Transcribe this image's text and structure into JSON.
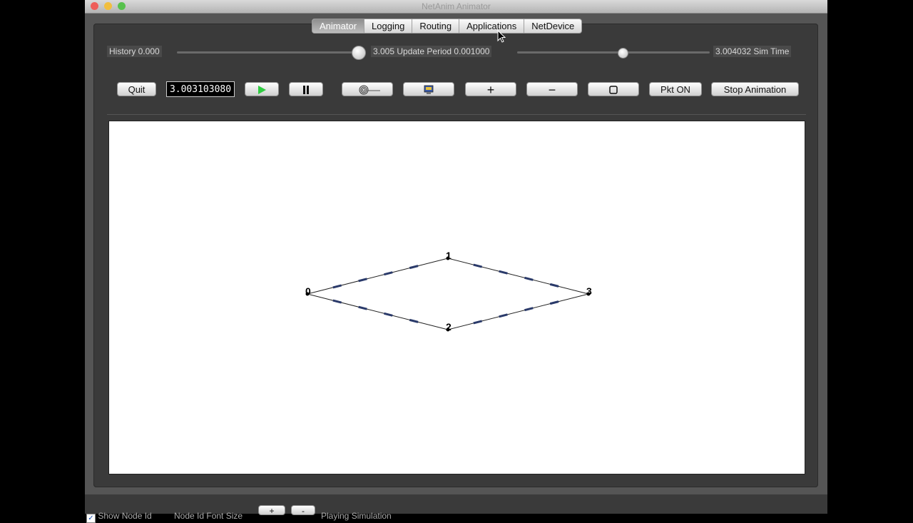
{
  "window": {
    "title": "NetAnim Animator"
  },
  "tabs": [
    {
      "label": "Animator",
      "active": true
    },
    {
      "label": "Logging",
      "active": false
    },
    {
      "label": "Routing",
      "active": false
    },
    {
      "label": "Applications",
      "active": false
    },
    {
      "label": "NetDevice",
      "active": false
    }
  ],
  "sliders": {
    "history_label": "History  0.000",
    "update_label": "3.005  Update Period 0.001000",
    "sim_time_label": "3.004032 Sim Time"
  },
  "toolbar": {
    "quit": "Quit",
    "time_display": "3.003103080",
    "play_icon": "play-icon",
    "pause_icon": "pause-icon",
    "fit_icon": "fingerprint-icon",
    "snapshot_icon": "snapshot-icon",
    "zoom_in": "+",
    "zoom_out": "−",
    "reset_icon": "stop-square-icon",
    "pkt": "Pkt ON",
    "stop_animation": "Stop Animation"
  },
  "topology": {
    "nodes": [
      {
        "id": "0",
        "x": 0,
        "y": 0
      },
      {
        "id": "1",
        "x": 1,
        "y": 1
      },
      {
        "id": "2",
        "x": 1,
        "y": -1
      },
      {
        "id": "3",
        "x": 2,
        "y": 0
      }
    ],
    "links": [
      [
        "0",
        "1"
      ],
      [
        "1",
        "3"
      ],
      [
        "0",
        "2"
      ],
      [
        "2",
        "3"
      ]
    ],
    "link_color": "#222222",
    "packet_color": "#2a3a6a"
  },
  "statusbar": {
    "show_node_id": "Show Node Id",
    "font_size_label": "Node Id Font Size",
    "inc": "+",
    "dec": "-",
    "status": "Playing Simulation"
  },
  "colors": {
    "accent_green": "#2ecc40"
  }
}
